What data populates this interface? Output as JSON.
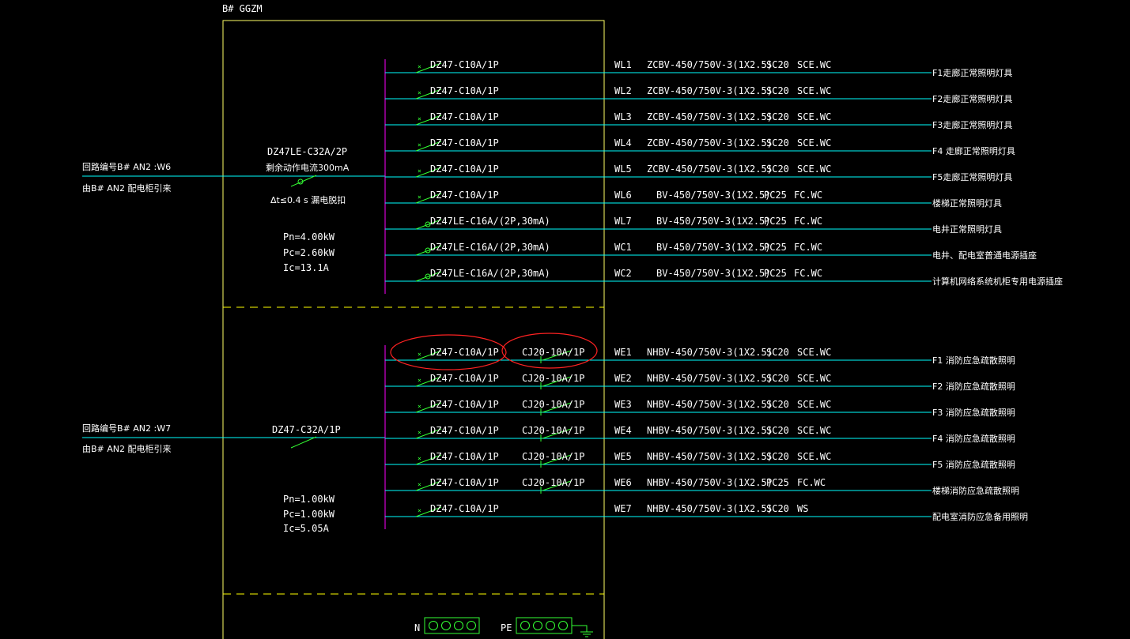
{
  "panel": {
    "name": "B# GGZM",
    "lighting": {
      "incoming_source": "回路编号B# AN2 :W6",
      "incoming_from": "由B# AN2 配电柜引来",
      "main_breaker": "DZ47LE-C32A/2P",
      "rcd_note": "剩余动作电流300mA",
      "trip_time": "Δt≤0.4 s  漏电脱扣",
      "pn": "Pn=4.00kW",
      "pc": "Pc=2.60kW",
      "ic": "Ic=13.1A",
      "circuits": [
        {
          "breaker": "DZ47-C10A/1P",
          "rcd": false,
          "id": "WL1",
          "cable": "ZCBV-450/750V-3(1X2.5)",
          "conduit": "SC20",
          "laying": "SCE.WC",
          "load": "F1走廊正常照明灯具"
        },
        {
          "breaker": "DZ47-C10A/1P",
          "rcd": false,
          "id": "WL2",
          "cable": "ZCBV-450/750V-3(1X2.5)",
          "conduit": "SC20",
          "laying": "SCE.WC",
          "load": "F2走廊正常照明灯具"
        },
        {
          "breaker": "DZ47-C10A/1P",
          "rcd": false,
          "id": "WL3",
          "cable": "ZCBV-450/750V-3(1X2.5)",
          "conduit": "SC20",
          "laying": "SCE.WC",
          "load": "F3走廊正常照明灯具"
        },
        {
          "breaker": "DZ47-C10A/1P",
          "rcd": false,
          "id": "WL4",
          "cable": "ZCBV-450/750V-3(1X2.5)",
          "conduit": "SC20",
          "laying": "SCE.WC",
          "load": "F4 走廊正常照明灯具"
        },
        {
          "breaker": "DZ47-C10A/1P",
          "rcd": false,
          "id": "WL5",
          "cable": "ZCBV-450/750V-3(1X2.5)",
          "conduit": "SC20",
          "laying": "SCE.WC",
          "load": "F5走廊正常照明灯具"
        },
        {
          "breaker": "DZ47-C10A/1P",
          "rcd": false,
          "id": "WL6",
          "cable": "BV-450/750V-3(1X2.5)",
          "conduit": "PC25",
          "laying": "FC.WC",
          "load": "楼梯正常照明灯具"
        },
        {
          "breaker": "DZ47LE-C16A/(2P,30mA)",
          "rcd": true,
          "id": "WL7",
          "cable": "BV-450/750V-3(1X2.5)",
          "conduit": "PC25",
          "laying": "FC.WC",
          "load": "电井正常照明灯具"
        },
        {
          "breaker": "DZ47LE-C16A/(2P,30mA)",
          "rcd": true,
          "id": "WC1",
          "cable": "BV-450/750V-3(1X2.5)",
          "conduit": "PC25",
          "laying": "FC.WC",
          "load": "电井、配电室普通电源插座"
        },
        {
          "breaker": "DZ47LE-C16A/(2P,30mA)",
          "rcd": true,
          "id": "WC2",
          "cable": "BV-450/750V-3(1X2.5)",
          "conduit": "PC25",
          "laying": "FC.WC",
          "load": "计算机网络系统机柜专用电源插座"
        }
      ]
    },
    "emergency": {
      "incoming_source": "回路编号B# AN2 :W7",
      "incoming_from": "由B# AN2 配电柜引来",
      "main_breaker": "DZ47-C32A/1P",
      "pn": "Pn=1.00kW",
      "pc": "Pc=1.00kW",
      "ic": "Ic=5.05A",
      "circuits": [
        {
          "breaker": "DZ47-C10A/1P",
          "contactor": "CJ20-10A/1P",
          "id": "WE1",
          "cable": "NHBV-450/750V-3(1X2.5)",
          "conduit": "SC20",
          "laying": "SCE.WC",
          "load": "F1 消防应急疏散照明",
          "circled": true
        },
        {
          "breaker": "DZ47-C10A/1P",
          "contactor": "CJ20-10A/1P",
          "id": "WE2",
          "cable": "NHBV-450/750V-3(1X2.5)",
          "conduit": "SC20",
          "laying": "SCE.WC",
          "load": "F2 消防应急疏散照明",
          "circled": false
        },
        {
          "breaker": "DZ47-C10A/1P",
          "contactor": "CJ20-10A/1P",
          "id": "WE3",
          "cable": "NHBV-450/750V-3(1X2.5)",
          "conduit": "SC20",
          "laying": "SCE.WC",
          "load": "F3 消防应急疏散照明",
          "circled": false
        },
        {
          "breaker": "DZ47-C10A/1P",
          "contactor": "CJ20-10A/1P",
          "id": "WE4",
          "cable": "NHBV-450/750V-3(1X2.5)",
          "conduit": "SC20",
          "laying": "SCE.WC",
          "load": "F4 消防应急疏散照明",
          "circled": false
        },
        {
          "breaker": "DZ47-C10A/1P",
          "contactor": "CJ20-10A/1P",
          "id": "WE5",
          "cable": "NHBV-450/750V-3(1X2.5)",
          "conduit": "SC20",
          "laying": "SCE.WC",
          "load": "F5 消防应急疏散照明",
          "circled": false
        },
        {
          "breaker": "DZ47-C10A/1P",
          "contactor": "CJ20-10A/1P",
          "id": "WE6",
          "cable": "NHBV-450/750V-3(1X2.5)",
          "conduit": "PC25",
          "laying": "FC.WC",
          "load": "楼梯消防应急疏散照明",
          "circled": false
        },
        {
          "breaker": "DZ47-C10A/1P",
          "contactor": "",
          "id": "WE7",
          "cable": "NHBV-450/750V-3(1X2.5)",
          "conduit": "SC20",
          "laying": "WS",
          "load": "配电室消防应急备用照明",
          "circled": false
        }
      ]
    },
    "busbars": {
      "n_label": "N",
      "pe_label": "PE"
    }
  },
  "colors": {
    "border": "#ffff66",
    "cable": "#00ffff",
    "breaker": "#33ff33",
    "busbar": "#ff00ff",
    "text": "#ffffff",
    "highlight": "#ff2222",
    "dashed": "#ffff00",
    "terminal": "#33ff33"
  }
}
